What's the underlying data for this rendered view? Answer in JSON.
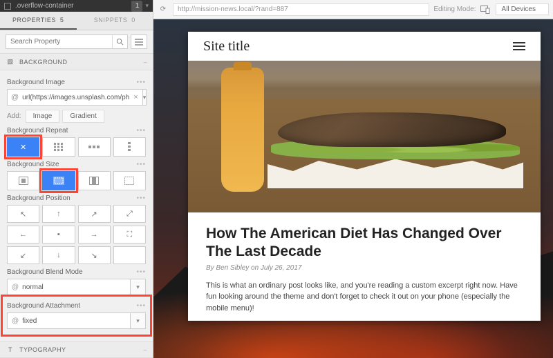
{
  "selector": {
    "name": ".overflow-container",
    "count": "1"
  },
  "tabs": {
    "properties": "PROPERTIES",
    "properties_count": "5",
    "snippets": "SNIPPETS",
    "snippets_count": "0"
  },
  "search": {
    "placeholder": "Search Property"
  },
  "sections": {
    "background": "BACKGROUND",
    "typography": "TYPOGRAPHY"
  },
  "props": {
    "bg_image": {
      "label": "Background Image",
      "value": "url(https://images.unsplash.com/ph"
    },
    "add": {
      "label": "Add:",
      "image": "Image",
      "gradient": "Gradient"
    },
    "bg_repeat": {
      "label": "Background Repeat"
    },
    "bg_size": {
      "label": "Background Size"
    },
    "bg_position": {
      "label": "Background Position"
    },
    "bg_blend": {
      "label": "Background Blend Mode",
      "value": "normal"
    },
    "bg_attach": {
      "label": "Background Attachment",
      "value": "fixed"
    }
  },
  "toolbar": {
    "url": "http://mission-news.local/?rand=887",
    "editing_mode": "Editing Mode:",
    "devices": "All Devices"
  },
  "page": {
    "site_title": "Site title",
    "article_title": "How The American Diet Has Changed Over The Last Decade",
    "byline": "By Ben Sibley on July 26, 2017",
    "excerpt": "This is what an ordinary post looks like, and you're reading a custom excerpt right now. Have fun looking around the theme and don't forget to check it out on your phone (especially the mobile menu)!"
  }
}
